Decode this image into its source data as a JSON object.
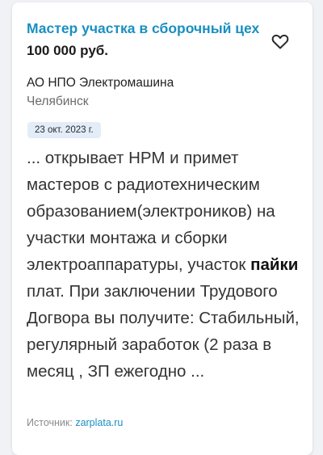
{
  "vacancy": {
    "title": "Мастер участка в сборочный цех",
    "salary": "100 000 руб.",
    "company": "АО НПО Электромашина",
    "city": "Челябинск",
    "date": "23 окт. 2023 г.",
    "description": {
      "before": "... открывает НРМ и примет мастеров с радиотехническим образованием(электроников) на участки монтажа и сборки электроаппаратуры, участок ",
      "highlight": "пайки",
      "after": " плат. При заключении Трудового Догвора вы получите: Стабильный, регулярный заработок (2 раза в месяц , ЗП ежегодно ..."
    },
    "source_label": "Источник: ",
    "source_link": "zarplata.ru"
  },
  "icons": {
    "favorite": "heart-outline-icon"
  },
  "colors": {
    "link": "#1a8fc1",
    "date_badge": "#e3edf9",
    "background": "#f0f2f5"
  }
}
